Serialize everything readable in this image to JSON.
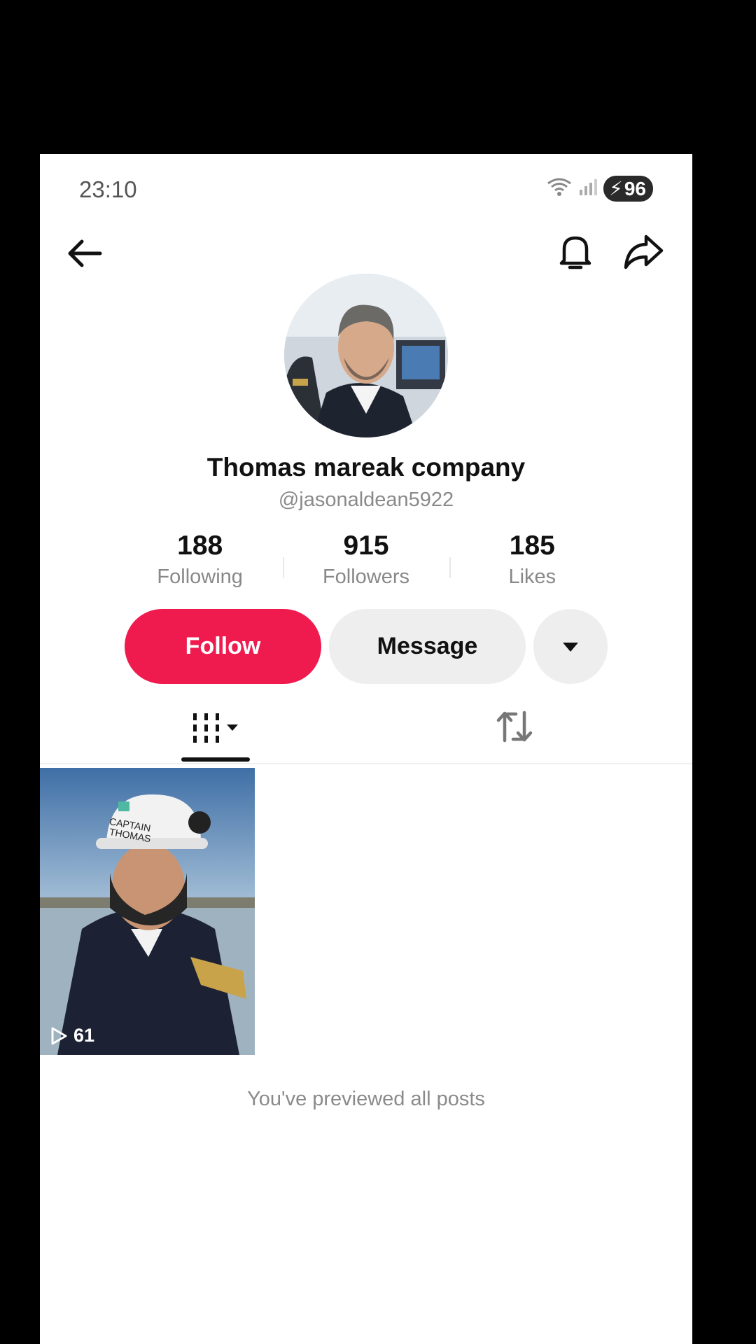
{
  "status_bar": {
    "time": "23:10",
    "battery": "96",
    "wifi_icon": "wifi-icon",
    "signal_icon": "signal-icon"
  },
  "nav": {
    "back_icon": "arrow-left-icon",
    "bell_icon": "bell-icon",
    "share_icon": "share-icon"
  },
  "profile": {
    "name": "Thomas mareak company",
    "handle": "@jasonaldean5922",
    "stats": [
      {
        "value": "188",
        "label": "Following"
      },
      {
        "value": "915",
        "label": "Followers"
      },
      {
        "value": "185",
        "label": "Likes"
      }
    ]
  },
  "actions": {
    "follow_label": "Follow",
    "message_label": "Message"
  },
  "posts": [
    {
      "views": "61",
      "helmet_text_1": "CAPTAIN",
      "helmet_text_2": "THOMAS"
    }
  ],
  "end_note": "You've previewed all posts",
  "colors": {
    "follow": "#ef1b4f",
    "secondary_button": "#eeeeee"
  }
}
